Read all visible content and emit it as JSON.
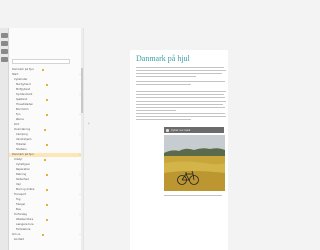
{
  "article": {
    "title": "Danmark på hjul"
  },
  "figure": {
    "caption_label": "Cykel i en mark"
  },
  "sidebar": {
    "items": [
      {
        "label": "Danmark på hjul",
        "active": false
      },
      {
        "label": "Start",
        "active": false
      },
      {
        "label": "Cykelruter",
        "active": false
      },
      {
        "label": "Nordjylland",
        "active": false
      },
      {
        "label": "Midtjylland",
        "active": false
      },
      {
        "label": "Syddanmark",
        "active": false
      },
      {
        "label": "Sjælland",
        "active": false
      },
      {
        "label": "Hovedstaden",
        "active": false
      },
      {
        "label": "Bornholm",
        "active": false
      },
      {
        "label": "Fyn",
        "active": false
      },
      {
        "label": "Øerne",
        "active": false
      },
      {
        "label": "Kort",
        "active": false
      },
      {
        "label": "Overnatning",
        "active": false
      },
      {
        "label": "Camping",
        "active": false
      },
      {
        "label": "Vandrehjem",
        "active": false
      },
      {
        "label": "Hoteller",
        "active": false
      },
      {
        "label": "Shelters",
        "active": false
      },
      {
        "label": "Danmark på hjul",
        "active": true
      },
      {
        "label": "Udstyr",
        "active": false
      },
      {
        "label": "Cykeltyper",
        "active": false
      },
      {
        "label": "Reparation",
        "active": false
      },
      {
        "label": "Pakning",
        "active": false
      },
      {
        "label": "Sikkerhed",
        "active": false
      },
      {
        "label": "Vejr",
        "active": false
      },
      {
        "label": "Mad og drikke",
        "active": false
      },
      {
        "label": "Transport",
        "active": false
      },
      {
        "label": "Tog",
        "active": false
      },
      {
        "label": "Færger",
        "active": false
      },
      {
        "label": "Bus",
        "active": false
      },
      {
        "label": "Turforslag",
        "active": false
      },
      {
        "label": "Weekendture",
        "active": false
      },
      {
        "label": "Længere ture",
        "active": false
      },
      {
        "label": "Familieture",
        "active": false
      },
      {
        "label": "Om os",
        "active": false
      },
      {
        "label": "Kontakt",
        "active": false
      }
    ]
  }
}
